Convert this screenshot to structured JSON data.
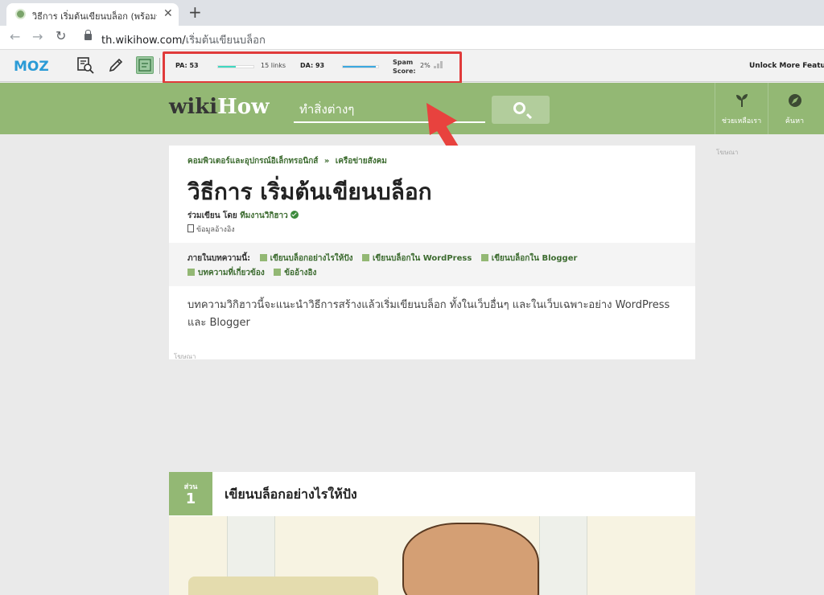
{
  "browser": {
    "tab_title": "วิธีการ เริ่มต้นเขียนบล็อก (พร้อมรูปภาพ",
    "tab_close": "✕",
    "new_tab": "+",
    "url_host": "th.wikihow.com/",
    "url_path": "เริ่มต้นเขียนบล็อก",
    "back_glyph": "←",
    "forward_glyph": "→",
    "reload_glyph": "↻"
  },
  "moz": {
    "logo": "MOZ",
    "pa_label": "PA: 53",
    "pa_bar_fraction": 0.5,
    "links": "15 links",
    "da_label": "DA: 93",
    "da_bar_fraction": 0.93,
    "spam_label_1": "Spam",
    "spam_label_2": "Score:",
    "spam_value": "2%",
    "unlock": "Unlock More Feature",
    "colors": {
      "pa_bar": "#3fd8c0",
      "da_bar": "#3ba8e0",
      "highlight": "#e03a3a",
      "arrow": "#e8423e"
    }
  },
  "wikihow": {
    "logo_wiki": "wiki",
    "logo_how": "How",
    "search_placeholder": "ทำสิ่งต่างๆ",
    "nav": [
      {
        "label": "ช่วยเหลือเรา",
        "icon": "sprout-icon"
      },
      {
        "label": "ค้นหา",
        "icon": "compass-icon"
      }
    ],
    "brand_color": "#93b874"
  },
  "article": {
    "breadcrumb_1": "คอมพิวเตอร์และอุปกรณ์อิเล็กทรอนิกส์",
    "breadcrumb_sep": "»",
    "breadcrumb_2": "เครือข่ายสังคม",
    "title": "วิธีการ เริ่มต้นเขียนบล็อก",
    "byline_prefix": "ร่วมเขียน โดย",
    "author": "ทีมงานวิกิฮาว",
    "references": "ข้อมูลอ้างอิง",
    "toc_label": "ภายในบทความนี้:",
    "toc": [
      "เขียนบล็อกอย่างไรให้ปัง",
      "เขียนบล็อกใน WordPress",
      "เขียนบล็อกใน Blogger",
      "บทความที่เกี่ยวข้อง",
      "ข้ออ้างอิง"
    ],
    "intro": "บทความวิกิฮาวนี้จะแนะนำวิธีการสร้างแล้วเริ่มเขียนบล็อก ทั้งในเว็บอื่นๆ และในเว็บเฉพาะอย่าง WordPress และ Blogger",
    "ad_label": "โฆษณา"
  },
  "section": {
    "part_label": "ส่วน",
    "part_number": "1",
    "title": "เขียนบล็อกอย่างไรให้ปัง"
  }
}
